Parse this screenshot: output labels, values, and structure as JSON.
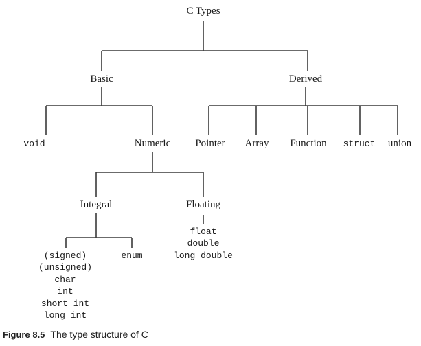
{
  "diagram": {
    "root": "C Types",
    "basic": "Basic",
    "derived": "Derived",
    "void": "void",
    "numeric": "Numeric",
    "integral": "Integral",
    "floating": "Floating",
    "integral_types": [
      "(signed)",
      "(unsigned)",
      "char",
      "int",
      "short int",
      "long int"
    ],
    "enum": "enum",
    "floating_types": [
      "float",
      "double",
      "long double"
    ],
    "derived_children": [
      "Pointer",
      "Array",
      "Function",
      "struct",
      "union"
    ]
  },
  "caption": {
    "label": "Figure 8.5",
    "text": "The type structure of C"
  }
}
